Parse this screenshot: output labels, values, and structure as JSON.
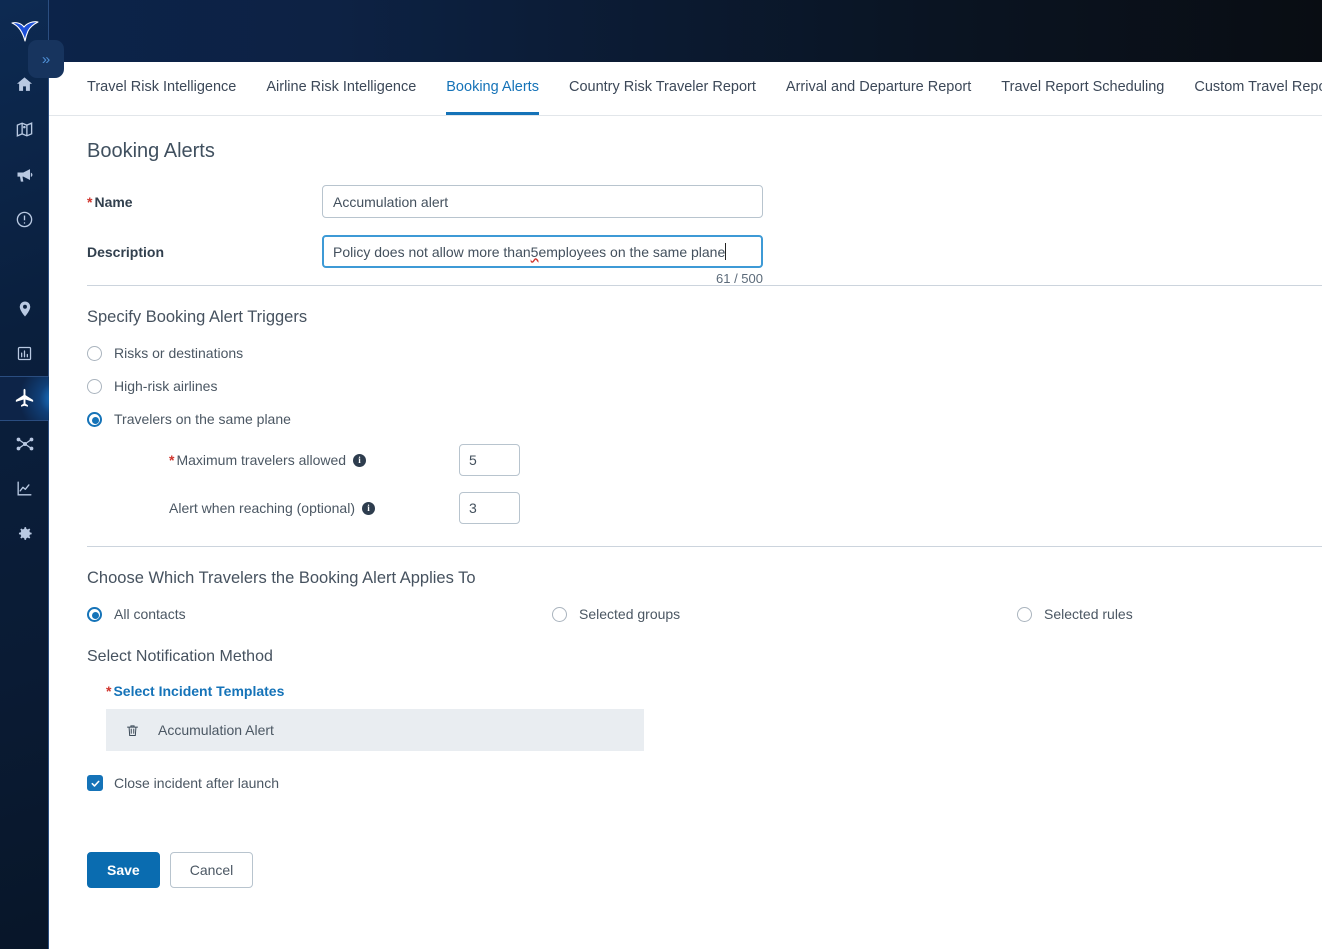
{
  "colors": {
    "accent": "#1573b8",
    "primary_button": "#0a6cb0",
    "required_star": "#d0342c",
    "sidebar_bg": "#0a1f3d",
    "focus_border": "#3d9ad6",
    "row_bg": "#e9edf1"
  },
  "sidebar": {
    "logo_name": "vendor-wing-logo",
    "collapse_label": "»",
    "items": [
      {
        "icon": "home-icon",
        "name": "sidebar-item-home",
        "active": false
      },
      {
        "icon": "map-pin-icon",
        "name": "sidebar-item-maps",
        "active": false
      },
      {
        "icon": "megaphone-icon",
        "name": "sidebar-item-broadcast",
        "active": false
      },
      {
        "icon": "alert-circle-icon",
        "name": "sidebar-item-incidents",
        "active": false
      },
      {
        "icon": "location-icon",
        "name": "sidebar-item-locations",
        "active": false
      },
      {
        "icon": "bar-chart-icon",
        "name": "sidebar-item-reports",
        "active": false
      },
      {
        "icon": "airplane-icon",
        "name": "sidebar-item-travel",
        "active": true
      },
      {
        "icon": "network-icon",
        "name": "sidebar-item-connections",
        "active": false
      },
      {
        "icon": "line-chart-icon",
        "name": "sidebar-item-analytics",
        "active": false
      },
      {
        "icon": "gear-icon",
        "name": "sidebar-item-settings",
        "active": false
      }
    ]
  },
  "tabs": [
    {
      "label": "Travel Risk Intelligence",
      "active": false
    },
    {
      "label": "Airline Risk Intelligence",
      "active": false
    },
    {
      "label": "Booking Alerts",
      "active": true
    },
    {
      "label": "Country Risk Traveler Report",
      "active": false
    },
    {
      "label": "Arrival and Departure Report",
      "active": false
    },
    {
      "label": "Travel Report Scheduling",
      "active": false
    },
    {
      "label": "Custom Travel Reports",
      "active": false
    }
  ],
  "page": {
    "title": "Booking Alerts"
  },
  "form": {
    "name_label": "Name",
    "name_required_mark": "*",
    "name_value": "Accumulation alert",
    "description_label": "Description",
    "description_value": "Policy does not allow more than 5 employees on the same plane",
    "description_prefix": "Policy does not allow more than ",
    "description_misspelled": "5",
    "description_suffix": " employees on the same plane",
    "char_count": "61 / 500"
  },
  "triggers": {
    "heading": "Specify Booking Alert Triggers",
    "options": [
      {
        "label": "Risks or destinations",
        "selected": false
      },
      {
        "label": "High-risk airlines",
        "selected": false
      },
      {
        "label": "Travelers on the same plane",
        "selected": true
      }
    ],
    "fields": [
      {
        "required_mark": "*",
        "label": "Maximum travelers allowed",
        "info_glyph": "i",
        "value": "5"
      },
      {
        "required_mark": "",
        "label": "Alert when reaching (optional)",
        "info_glyph": "i",
        "value": "3"
      }
    ]
  },
  "applies_to": {
    "heading": "Choose Which Travelers the Booking Alert Applies To",
    "options": [
      {
        "label": "All contacts",
        "selected": true
      },
      {
        "label": "Selected groups",
        "selected": false
      },
      {
        "label": "Selected rules",
        "selected": false
      }
    ]
  },
  "notification": {
    "heading": "Select Notification Method",
    "templates_required_mark": "*",
    "templates_label": "Select Incident Templates",
    "template_rows": [
      {
        "name": "Accumulation Alert",
        "delete_icon": "trash-icon"
      }
    ],
    "close_incident_label": "Close incident after launch",
    "close_incident_checked": true
  },
  "actions": {
    "save_label": "Save",
    "cancel_label": "Cancel"
  }
}
